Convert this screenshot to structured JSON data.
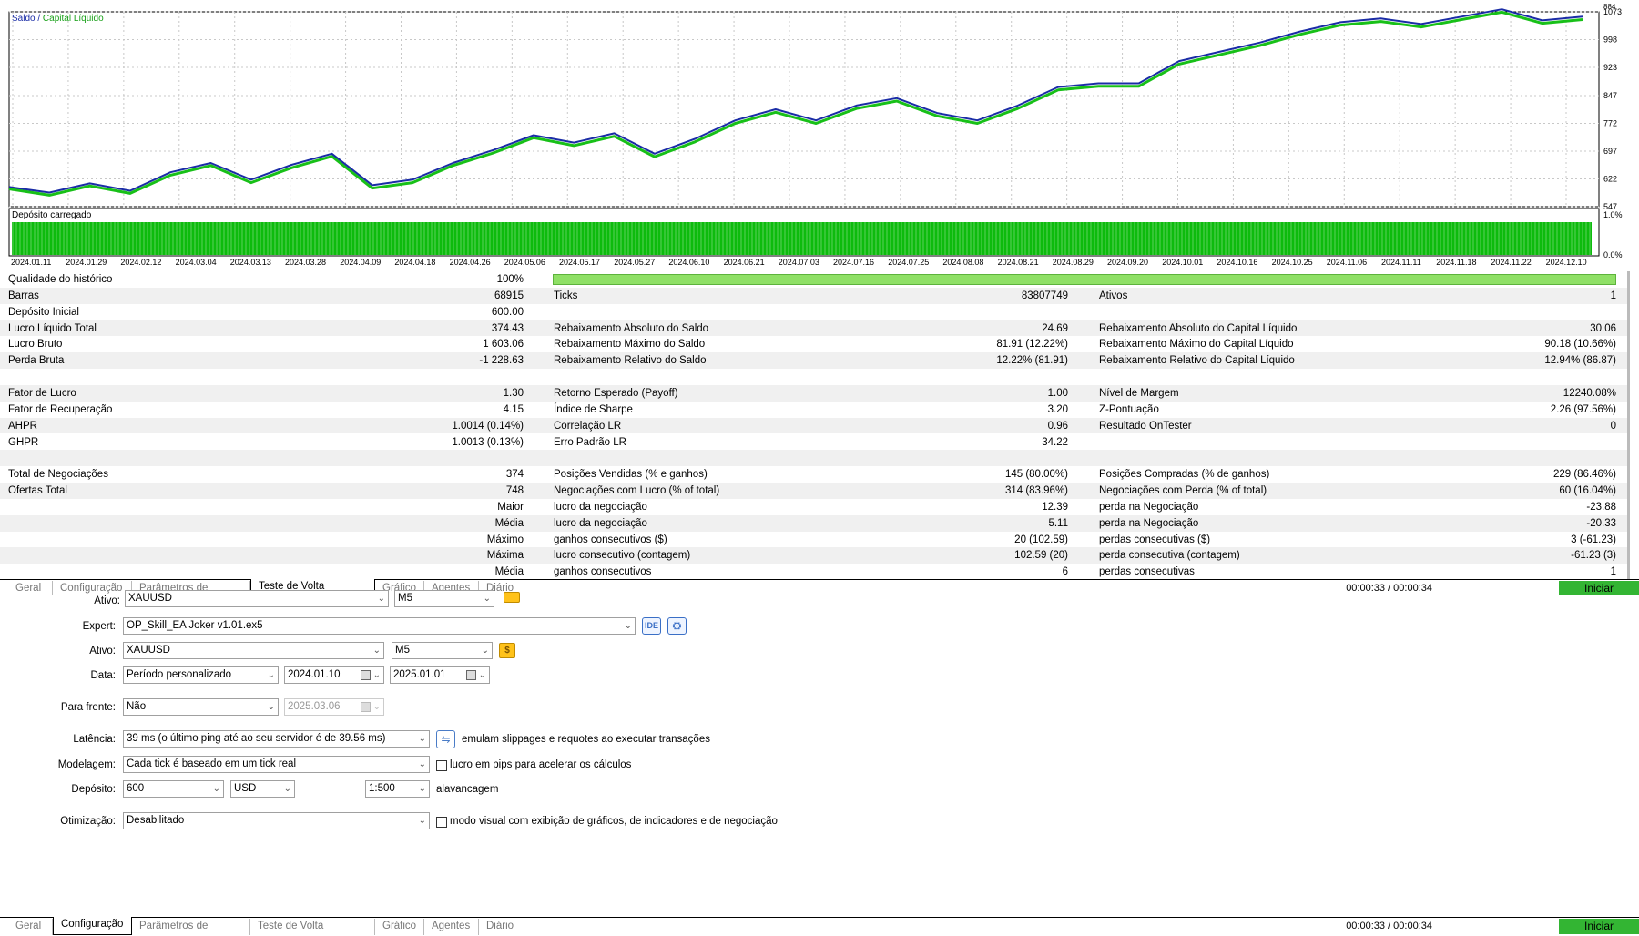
{
  "chart": {
    "legend_balance": "Saldo",
    "legend_sep": "/",
    "legend_equity": "Capital Líquido",
    "deposit_load_label": "Depósito carregado",
    "y_labels": [
      "1073",
      "998",
      "923",
      "847",
      "772",
      "697",
      "622",
      "547"
    ],
    "y_top_partial": "884",
    "load_labels": [
      "1.0%",
      "0.0%"
    ],
    "x_labels": [
      "2024.01.11",
      "2024.01.29",
      "2024.02.12",
      "2024.03.04",
      "2024.03.13",
      "2024.03.28",
      "2024.04.09",
      "2024.04.18",
      "2024.04.26",
      "2024.05.06",
      "2024.05.17",
      "2024.05.27",
      "2024.06.10",
      "2024.06.21",
      "2024.07.03",
      "2024.07.16",
      "2024.07.25",
      "2024.08.08",
      "2024.08.21",
      "2024.08.29",
      "2024.09.20",
      "2024.10.01",
      "2024.10.16",
      "2024.10.25",
      "2024.11.06",
      "2024.11.11",
      "2024.11.18",
      "2024.11.22",
      "2024.12.10"
    ],
    "colors": {
      "balance": "#1a2ca6",
      "equity": "#18c018",
      "deposit_load": "#0dbb0d"
    }
  },
  "chart_data": {
    "type": "line",
    "title": "",
    "series": [
      {
        "name": "Saldo",
        "values": [
          600,
          585,
          610,
          590,
          640,
          665,
          620,
          660,
          690,
          605,
          620,
          665,
          700,
          740,
          720,
          745,
          690,
          730,
          780,
          810,
          780,
          820,
          840,
          800,
          780,
          820,
          870,
          880,
          880,
          940,
          965,
          990,
          1020,
          1045,
          1055,
          1040,
          1060,
          1080,
          1050,
          1060
        ]
      },
      {
        "name": "Capital Líquido",
        "values": [
          595,
          578,
          603,
          583,
          632,
          658,
          612,
          652,
          683,
          597,
          612,
          658,
          692,
          733,
          712,
          737,
          682,
          722,
          772,
          802,
          772,
          812,
          832,
          792,
          772,
          812,
          862,
          872,
          872,
          932,
          957,
          982,
          1012,
          1037,
          1047,
          1032,
          1052,
          1072,
          1042,
          1052
        ]
      }
    ],
    "x_range": [
      "2024.01.11",
      "2024.12.10"
    ],
    "ylim": [
      547,
      1073
    ],
    "grid": true,
    "legend": "top-left"
  },
  "results": {
    "rows": [
      {
        "c1l": "Qualidade do histórico",
        "c1v": "100%",
        "c2l": "",
        "c2v": "",
        "c3l": "",
        "c3v": "",
        "bar": true
      },
      {
        "c1l": "Barras",
        "c1v": "68915",
        "c2l": "Ticks",
        "c2v": "83807749",
        "c3l": "Ativos",
        "c3v": "1"
      },
      {
        "c1l": "Depósito Inicial",
        "c1v": "600.00",
        "c2l": "",
        "c2v": "",
        "c3l": "",
        "c3v": ""
      },
      {
        "c1l": "Lucro Líquido Total",
        "c1v": "374.43",
        "c2l": "Rebaixamento Absoluto do Saldo",
        "c2v": "24.69",
        "c3l": "Rebaixamento Absoluto do Capital Líquido",
        "c3v": "30.06"
      },
      {
        "c1l": "Lucro Bruto",
        "c1v": "1 603.06",
        "c2l": "Rebaixamento Máximo do Saldo",
        "c2v": "81.91 (12.22%)",
        "c3l": "Rebaixamento Máximo do Capital Líquido",
        "c3v": "90.18 (10.66%)"
      },
      {
        "c1l": "Perda Bruta",
        "c1v": "-1 228.63",
        "c2l": "Rebaixamento Relativo do Saldo",
        "c2v": "12.22% (81.91)",
        "c3l": "Rebaixamento Relativo do Capital Líquido",
        "c3v": "12.94% (86.87)"
      },
      {
        "c1l": "",
        "c1v": "",
        "c2l": "",
        "c2v": "",
        "c3l": "",
        "c3v": ""
      },
      {
        "c1l": "Fator de Lucro",
        "c1v": "1.30",
        "c2l": "Retorno Esperado (Payoff)",
        "c2v": "1.00",
        "c3l": "Nível de Margem",
        "c3v": "12240.08%"
      },
      {
        "c1l": "Fator de Recuperação",
        "c1v": "4.15",
        "c2l": "Índice de Sharpe",
        "c2v": "3.20",
        "c3l": "Z-Pontuação",
        "c3v": "2.26 (97.56%)"
      },
      {
        "c1l": "AHPR",
        "c1v": "1.0014 (0.14%)",
        "c2l": "Correlação LR",
        "c2v": "0.96",
        "c3l": "Resultado OnTester",
        "c3v": "0"
      },
      {
        "c1l": "GHPR",
        "c1v": "1.0013 (0.13%)",
        "c2l": "Erro Padrão LR",
        "c2v": "34.22",
        "c3l": "",
        "c3v": ""
      },
      {
        "c1l": "",
        "c1v": "",
        "c2l": "",
        "c2v": "",
        "c3l": "",
        "c3v": ""
      },
      {
        "c1l": "Total de Negociações",
        "c1v": "374",
        "c2l": "Posições Vendidas (% e ganhos)",
        "c2v": "145 (80.00%)",
        "c3l": "Posições Compradas (% de ganhos)",
        "c3v": "229 (86.46%)"
      },
      {
        "c1l": "Ofertas Total",
        "c1v": "748",
        "c2l": "Negociações com Lucro (% of total)",
        "c2v": "314 (83.96%)",
        "c3l": "Negociações com Perda (% of total)",
        "c3v": "60 (16.04%)"
      },
      {
        "c1l": "",
        "c1v": "Maior",
        "c2l": "lucro da negociação",
        "c2v": "12.39",
        "c3l": "perda na Negociação",
        "c3v": "-23.88"
      },
      {
        "c1l": "",
        "c1v": "Média",
        "c2l": "lucro da negociação",
        "c2v": "5.11",
        "c3l": "perda na Negociação",
        "c3v": "-20.33"
      },
      {
        "c1l": "",
        "c1v": "Máximo",
        "c2l": "ganhos consecutivos ($)",
        "c2v": "20 (102.59)",
        "c3l": "perdas consecutivas ($)",
        "c3v": "3 (-61.23)"
      },
      {
        "c1l": "",
        "c1v": "Máxima",
        "c2l": "lucro consecutivo (contagem)",
        "c2v": "102.59 (20)",
        "c3l": "perda consecutiva (contagem)",
        "c3v": "-61.23 (3)"
      },
      {
        "c1l": "",
        "c1v": "Média",
        "c2l": "ganhos consecutivos",
        "c2v": "6",
        "c3l": "perdas consecutivas",
        "c3v": "1"
      }
    ]
  },
  "tabs": {
    "items": [
      "Geral",
      "Configuração",
      "Parâmetros de entrada",
      "Teste de Volta (backtest)",
      "Gráfico",
      "Agentes",
      "Diário"
    ],
    "timer": "00:00:33 / 00:00:34",
    "start_label": "Iniciar"
  },
  "settings": {
    "partial_ativo_label": "Ativo:",
    "partial_ativo_value": "XAUUSD",
    "partial_tf_value": "M5",
    "expert_label": "Expert:",
    "expert_value": "OP_Skill_EA Joker v1.01.ex5",
    "ide_label": "IDE",
    "ativo_label": "Ativo:",
    "ativo_value": "XAUUSD",
    "tf_value": "M5",
    "coin_symbol": "$",
    "data_label": "Data:",
    "period_value": "Período personalizado",
    "date_from": "2024.01.10",
    "date_to": "2025.01.01",
    "forward_label": "Para frente:",
    "forward_value": "Não",
    "forward_date": "2025.03.06",
    "latency_label": "Latência:",
    "latency_value": "39 ms (o último ping até ao seu servidor é de 39.56 ms)",
    "slippage_text": "emulam slippages e requotes ao executar transações",
    "model_label": "Modelagem:",
    "model_value": "Cada tick é baseado em um tick real",
    "pips_text": "lucro em pips para acelerar os cálculos",
    "deposit_label": "Depósito:",
    "deposit_value": "600",
    "currency_value": "USD",
    "leverage_value": "1:500",
    "leverage_text": "alavancagem",
    "optim_label": "Otimização:",
    "optim_value": "Desabilitado",
    "visual_text": "modo visual com exibição de gráficos, de indicadores e de negociação"
  }
}
